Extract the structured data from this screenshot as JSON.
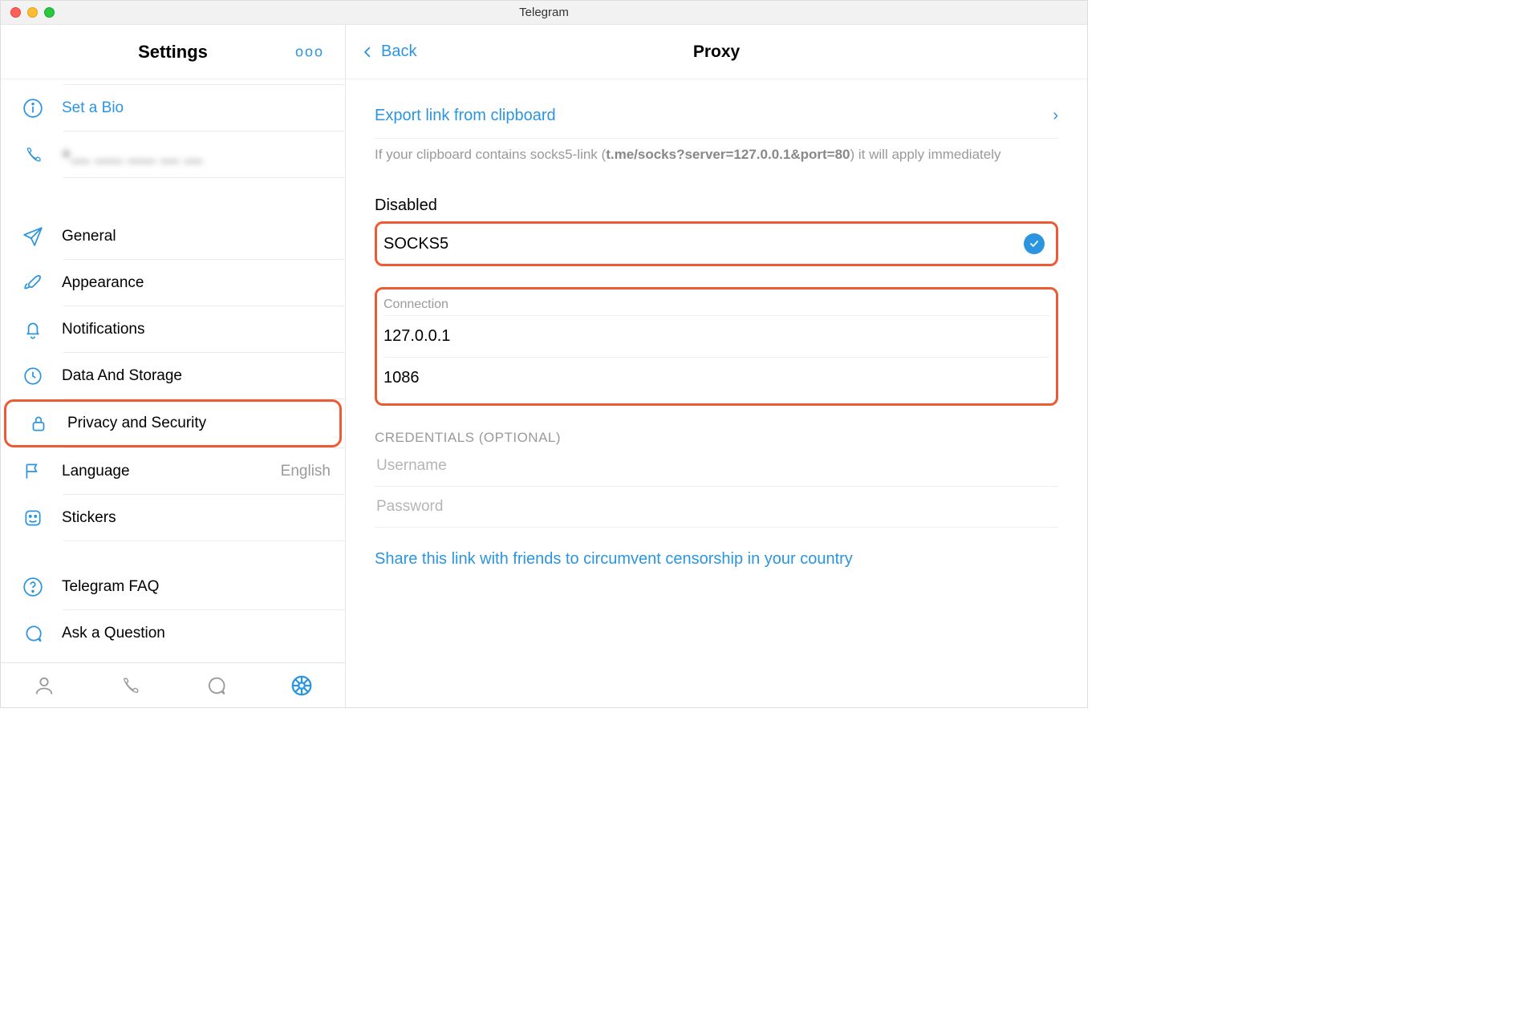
{
  "titlebar": {
    "app_title": "Telegram"
  },
  "sidebar": {
    "heading": "Settings",
    "more_label": "ooo",
    "items": {
      "set_bio": {
        "label": "Set a Bio"
      },
      "phone": {
        "label": ""
      },
      "general": {
        "label": "General"
      },
      "appearance": {
        "label": "Appearance"
      },
      "notifications": {
        "label": "Notifications"
      },
      "data_storage": {
        "label": "Data And Storage"
      },
      "privacy": {
        "label": "Privacy and Security"
      },
      "language": {
        "label": "Language",
        "value": "English"
      },
      "stickers": {
        "label": "Stickers"
      },
      "faq": {
        "label": "Telegram FAQ"
      },
      "ask": {
        "label": "Ask a Question"
      }
    }
  },
  "main": {
    "back_label": "Back",
    "title": "Proxy",
    "export": {
      "label": "Export link from clipboard",
      "hint_prefix": "If your clipboard contains socks5-link (",
      "hint_code": "t.me/socks?server=127.0.0.1&port=80",
      "hint_suffix": ") it will apply immediately"
    },
    "status_label": "Disabled",
    "proxy_type": {
      "label": "SOCKS5",
      "selected": true
    },
    "connection": {
      "heading": "Connection",
      "host": "127.0.0.1",
      "port": "1086"
    },
    "credentials": {
      "heading": "CREDENTIALS (OPTIONAL)",
      "username_placeholder": "Username",
      "password_placeholder": "Password",
      "username": "",
      "password": ""
    },
    "share_link_label": "Share this link with friends to circumvent censorship in your country"
  }
}
